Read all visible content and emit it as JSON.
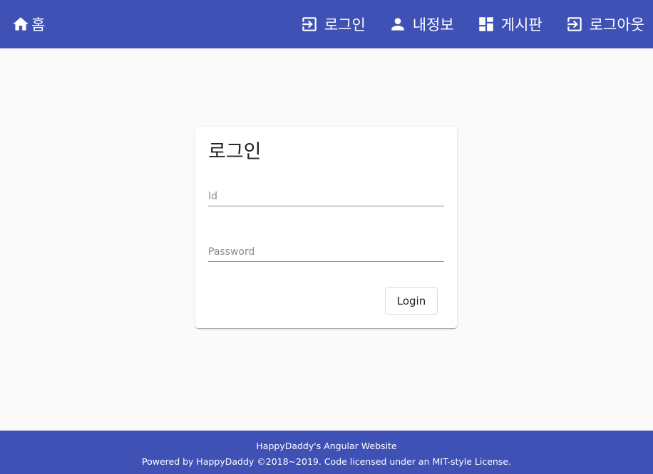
{
  "header": {
    "home": {
      "label": "홈",
      "icon": "home-icon"
    },
    "nav": [
      {
        "label": "로그인",
        "icon": "login-icon"
      },
      {
        "label": "내정보",
        "icon": "person-icon"
      },
      {
        "label": "게시판",
        "icon": "dashboard-icon"
      },
      {
        "label": "로그아웃",
        "icon": "logout-icon"
      }
    ]
  },
  "login_card": {
    "title": "로그인",
    "id_placeholder": "Id",
    "password_placeholder": "Password",
    "submit_label": "Login"
  },
  "footer": {
    "line1": "HappyDaddy's Angular Website",
    "line2": "Powered by HappyDaddy ©2018~2019. Code licensed under an MIT-style License."
  },
  "colors": {
    "primary": "#3f51b5",
    "background": "#fafafa"
  }
}
